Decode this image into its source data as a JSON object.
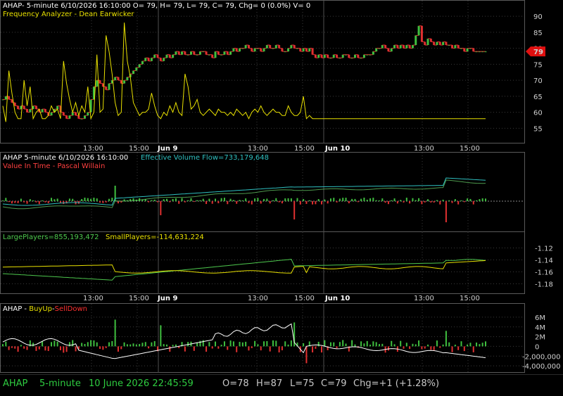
{
  "colors": {
    "up": "#3fbf3f",
    "down": "#e03030",
    "yellow": "#e8e000",
    "green_line": "#4ec94e",
    "cyan": "#2fc0c0",
    "white": "#ffffff",
    "red_text": "#ff4040",
    "status_green": "#2ecc40"
  },
  "price_header": {
    "line1": "AHAP- 5-minute 6/10/2026 16:10:00 O= 79, H= 79, L= 79, C= 79, Chg= 0 (0.0%) V= 0",
    "line2": "Frequency Analyzer - Dean Earwicker"
  },
  "price_axis": {
    "ticks": [
      "90",
      "85",
      "80",
      "75",
      "70",
      "65",
      "60",
      "55"
    ],
    "last_price_label": "79"
  },
  "time_axis": {
    "labels": [
      "13:00",
      "15:00",
      "Jun 9",
      "13:00",
      "15:00",
      "Jun 10",
      "13:00",
      "15:00"
    ]
  },
  "volume_header": {
    "title": "AHAP 5-minute  6/10/2026 16:10:00",
    "indicator": "Effective Volume Flow=733,179,648",
    "line2": "Value In Time - Pascal Willain"
  },
  "players_header": {
    "large": "LargePlayers=855,193,472",
    "small": "SmallPlayers=-114,631,224"
  },
  "players_axis": {
    "ticks": [
      "-1.12",
      "-1.14",
      "-1.16",
      "-1.18"
    ]
  },
  "buyup_header": {
    "prefix": "AHAP - ",
    "buy": "BuyUp",
    "sep": "-",
    "sell": "SellDown"
  },
  "buyup_axis": {
    "ticks": [
      "6M",
      "4M",
      "2M",
      "0",
      "-2,000,000",
      "-4,000,000"
    ]
  },
  "status": {
    "symbol": "AHAP",
    "interval": "5-minute",
    "datetime": "10 June 2026 22:45:59",
    "open": "O=78",
    "high": "H=87",
    "low": "L=75",
    "close": "C=79",
    "change": "Chg=+1 (+1.28%)"
  },
  "chart_data": [
    {
      "type": "candlestick",
      "title": "AHAP- 5-minute",
      "ylim": [
        52,
        92
      ],
      "y_ticks": [
        55,
        60,
        65,
        70,
        75,
        80,
        85,
        90
      ],
      "last_price": 79,
      "close_series": [
        64,
        65,
        64,
        63,
        62,
        61,
        62,
        61,
        60,
        61,
        62,
        61,
        60,
        61,
        60,
        59,
        60,
        61,
        62,
        60,
        59,
        58,
        59,
        60,
        59,
        58,
        58,
        59,
        60,
        64,
        68,
        70,
        69,
        68,
        67,
        69,
        70,
        71,
        70,
        69,
        70,
        71,
        72,
        73,
        74,
        75,
        76,
        77,
        76,
        77,
        78,
        77,
        76,
        77,
        78,
        77,
        78,
        79,
        78,
        79,
        78,
        78,
        79,
        78,
        78,
        79,
        79,
        78,
        78,
        77,
        79,
        78,
        78,
        79,
        78,
        79,
        80,
        79,
        80,
        80,
        81,
        80,
        79,
        80,
        80,
        79,
        80,
        81,
        80,
        80,
        81,
        80,
        79,
        79,
        80,
        81,
        80,
        80,
        79,
        80,
        79,
        80,
        78,
        77,
        78,
        77,
        78,
        77,
        77,
        78,
        77,
        77,
        78,
        78,
        77,
        77,
        78,
        77,
        77,
        78,
        78,
        78,
        79,
        80,
        80,
        81,
        80,
        79,
        80,
        81,
        80,
        81,
        80,
        81,
        80,
        81,
        84,
        87,
        82,
        81,
        83,
        82,
        81,
        82,
        81,
        82,
        81,
        81,
        80,
        81,
        80,
        80,
        79,
        80,
        80,
        79,
        79,
        79,
        79,
        79
      ],
      "freq_analyzer_series": [
        62,
        57,
        73,
        66,
        60,
        58,
        58,
        70,
        62,
        68,
        58,
        60,
        61,
        58,
        58,
        59,
        62,
        60,
        61,
        58,
        76,
        69,
        64,
        60,
        63,
        59,
        62,
        60,
        68,
        58,
        60,
        78,
        60,
        61,
        84,
        79,
        72,
        63,
        59,
        60,
        88,
        76,
        71,
        63,
        61,
        59,
        60,
        60,
        61,
        66,
        62,
        59,
        58,
        60,
        59,
        62,
        60,
        63,
        60,
        59,
        72,
        68,
        61,
        62,
        64,
        60,
        59,
        60,
        61,
        60,
        59,
        61,
        60,
        60,
        59,
        60,
        59,
        61,
        60,
        59,
        60,
        58,
        60,
        61,
        60,
        62,
        60,
        59,
        60,
        61,
        60,
        60,
        59,
        59,
        62,
        60,
        59,
        59,
        60,
        65,
        58,
        59,
        58,
        58,
        58,
        58,
        58,
        58,
        58,
        58,
        58,
        58,
        58,
        58,
        58,
        58,
        58,
        58,
        58,
        58,
        58,
        58,
        58,
        58,
        58,
        58,
        58,
        58,
        58,
        58,
        58,
        58,
        58,
        58,
        58,
        58,
        58,
        58,
        58,
        58,
        58,
        58,
        58,
        58,
        58,
        58,
        58,
        58,
        58,
        58,
        58,
        58,
        58,
        58,
        58,
        58,
        58,
        58,
        58,
        58
      ]
    },
    {
      "type": "bar",
      "title": "AHAP 5-minute 6/10/2026 16:10:00",
      "series": [
        {
          "name": "Effective Volume Flow",
          "value": 733179648
        }
      ]
    },
    {
      "type": "line",
      "series": [
        {
          "name": "LargePlayers",
          "value": 855193472
        },
        {
          "name": "SmallPlayers",
          "value": -114631224
        }
      ],
      "ylim": [
        -1.19,
        -1.11
      ],
      "y_ticks": [
        -1.12,
        -1.14,
        -1.16,
        -1.18
      ]
    },
    {
      "type": "bar",
      "series": [
        {
          "name": "BuyUp"
        },
        {
          "name": "SellDown"
        }
      ],
      "ylim": [
        -5000000,
        7000000
      ],
      "y_ticks": [
        6000000,
        4000000,
        2000000,
        0,
        -2000000,
        -4000000
      ]
    }
  ]
}
